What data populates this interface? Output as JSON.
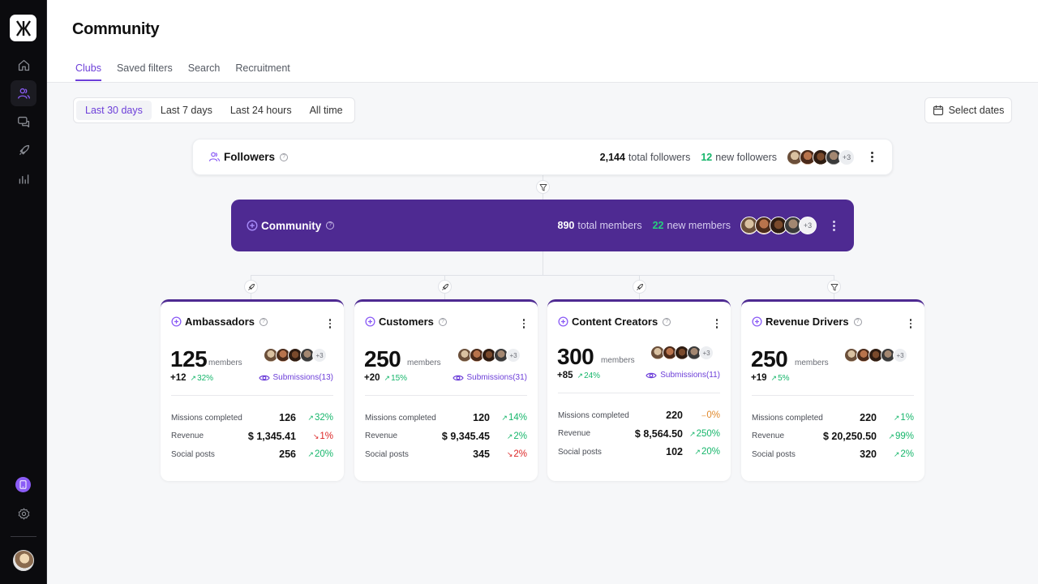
{
  "sidebar": {
    "nav": [
      {
        "icon": "home-icon",
        "active": false
      },
      {
        "icon": "users-icon",
        "active": true
      },
      {
        "icon": "messages-icon",
        "active": false
      },
      {
        "icon": "rocket-icon",
        "active": false
      },
      {
        "icon": "bar-chart-icon",
        "active": false
      }
    ],
    "bottom": [
      "mobile-app-icon",
      "gear-icon",
      "user-avatar"
    ]
  },
  "header": {
    "title": "Community",
    "tabs": [
      {
        "label": "Clubs",
        "active": true
      },
      {
        "label": "Saved filters",
        "active": false
      },
      {
        "label": "Search",
        "active": false
      },
      {
        "label": "Recruitment",
        "active": false
      }
    ]
  },
  "filters": {
    "ranges": [
      {
        "label": "Last 30 days",
        "active": true
      },
      {
        "label": "Last 7 days",
        "active": false
      },
      {
        "label": "Last 24 hours",
        "active": false
      },
      {
        "label": "All time",
        "active": false
      }
    ],
    "select_dates": "Select dates"
  },
  "followers": {
    "title": "Followers",
    "total": "2,144",
    "total_label": "total followers",
    "new": "12",
    "new_label": "new followers",
    "more_avatars": "+3"
  },
  "community": {
    "title": "Community",
    "total": "890",
    "total_label": "total members",
    "new": "22",
    "new_label": "new members",
    "more_avatars": "+3"
  },
  "connectors": [
    "filter-icon",
    "rocket-icon",
    "rocket-icon",
    "rocket-icon",
    "filter-icon"
  ],
  "members_label": "members",
  "clubs": [
    {
      "name": "Ambassadors",
      "members": "125",
      "delta": "+12",
      "delta_pct": "32%",
      "more_avatars": "+3",
      "submissions": "Submissions(13)",
      "metrics": [
        {
          "label": "Missions completed",
          "value": "126",
          "trend": "32%",
          "dir": "up"
        },
        {
          "label": "Revenue",
          "value": "$ 1,345.41",
          "trend": "1%",
          "dir": "down"
        },
        {
          "label": "Social posts",
          "value": "256",
          "trend": "20%",
          "dir": "up"
        }
      ]
    },
    {
      "name": "Customers",
      "members": "250",
      "delta": "+20",
      "delta_pct": "15%",
      "more_avatars": "+3",
      "submissions": "Submissions(31)",
      "metrics": [
        {
          "label": "Missions completed",
          "value": "120",
          "trend": "14%",
          "dir": "up"
        },
        {
          "label": "Revenue",
          "value": "$ 9,345.45",
          "trend": "2%",
          "dir": "up"
        },
        {
          "label": "Social posts",
          "value": "345",
          "trend": "2%",
          "dir": "down"
        }
      ]
    },
    {
      "name": "Content Creators",
      "members": "300",
      "delta": "+85",
      "delta_pct": "24%",
      "more_avatars": "+3",
      "submissions": "Submissions(11)",
      "metrics": [
        {
          "label": "Missions completed",
          "value": "220",
          "trend": "0%",
          "dir": "flat"
        },
        {
          "label": "Revenue",
          "value": "$ 8,564.50",
          "trend": "250%",
          "dir": "up"
        },
        {
          "label": "Social posts",
          "value": "102",
          "trend": "20%",
          "dir": "up"
        }
      ]
    },
    {
      "name": "Revenue Drivers",
      "members": "250",
      "delta": "+19",
      "delta_pct": "5%",
      "more_avatars": "+3",
      "submissions": null,
      "metrics": [
        {
          "label": "Missions completed",
          "value": "220",
          "trend": "1%",
          "dir": "up"
        },
        {
          "label": "Revenue",
          "value": "$ 20,250.50",
          "trend": "99%",
          "dir": "up"
        },
        {
          "label": "Social posts",
          "value": "320",
          "trend": "2%",
          "dir": "up"
        }
      ]
    }
  ]
}
